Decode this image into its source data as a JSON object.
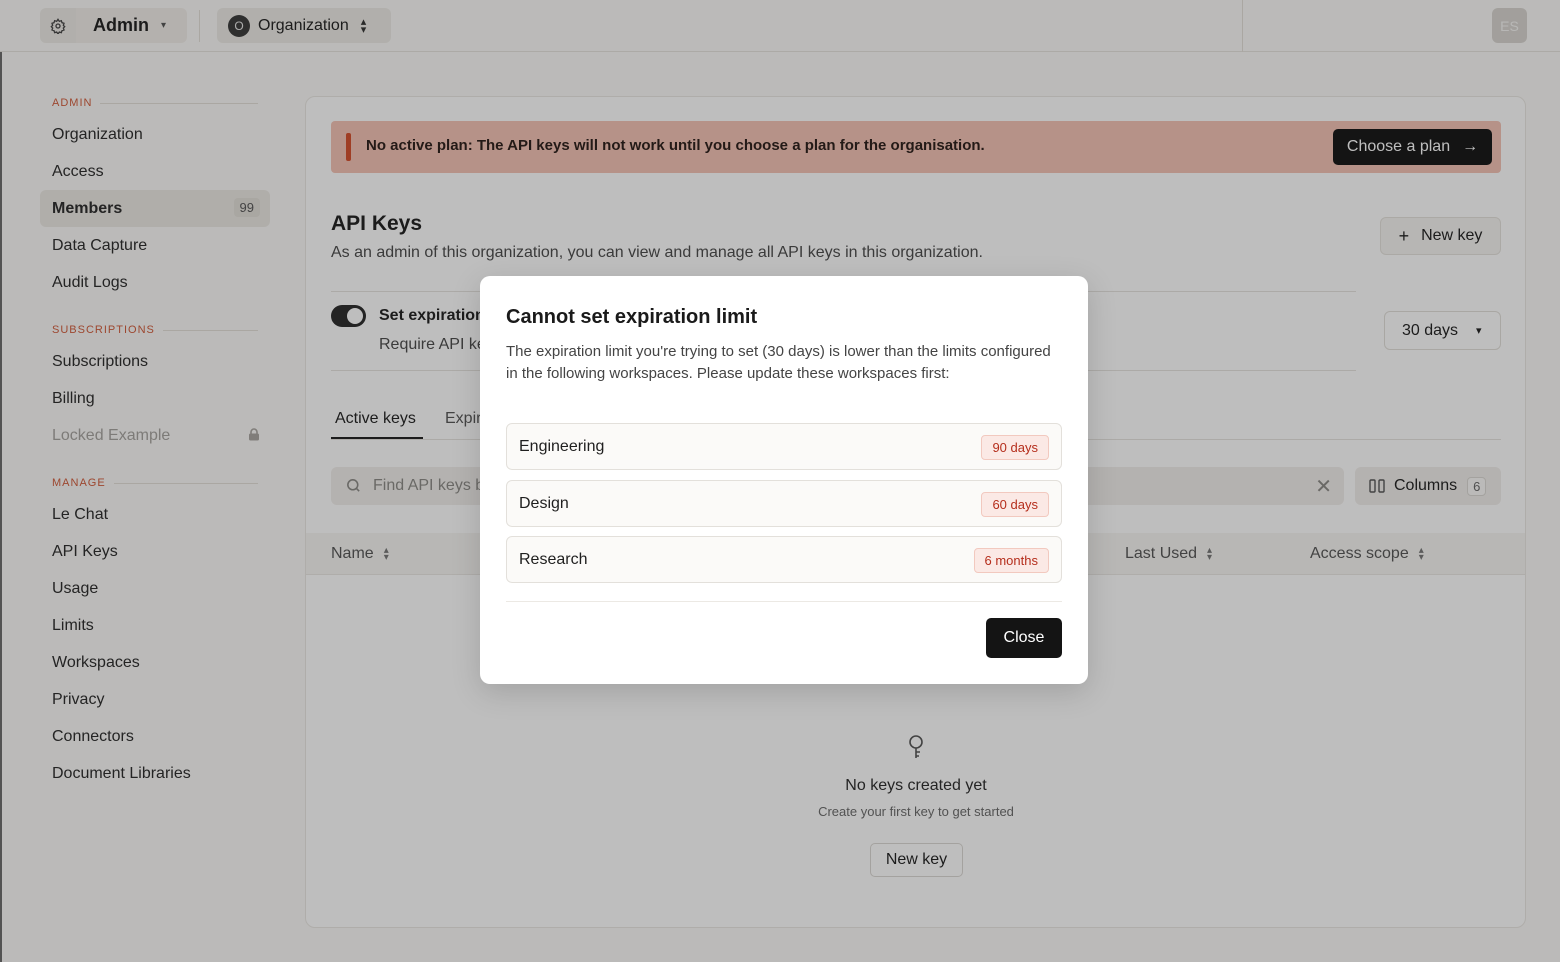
{
  "topbar": {
    "admin_label": "Admin",
    "org_initial": "O",
    "org_label": "Organization",
    "user_initials": "ES"
  },
  "sidebar": {
    "sections": [
      {
        "title": "ADMIN",
        "items": [
          {
            "label": "Organization"
          },
          {
            "label": "Access"
          },
          {
            "label": "Members",
            "count": "99",
            "active": true
          },
          {
            "label": "Data Capture"
          },
          {
            "label": "Audit Logs"
          }
        ]
      },
      {
        "title": "SUBSCRIPTIONS",
        "items": [
          {
            "label": "Subscriptions"
          },
          {
            "label": "Billing"
          },
          {
            "label": "Locked Example",
            "locked": true
          }
        ]
      },
      {
        "title": "MANAGE",
        "items": [
          {
            "label": "Le Chat"
          },
          {
            "label": "API Keys"
          },
          {
            "label": "Usage"
          },
          {
            "label": "Limits"
          },
          {
            "label": "Workspaces"
          },
          {
            "label": "Privacy"
          },
          {
            "label": "Connectors"
          },
          {
            "label": "Document Libraries"
          }
        ]
      }
    ]
  },
  "banner": {
    "message": "No active plan: The API keys will not work until you choose a plan for the organisation.",
    "button_label": "Choose a plan"
  },
  "page": {
    "title": "API Keys",
    "subtitle": "As an admin of this organization, you can view and manage all API keys in this organization.",
    "new_key_label": "New key"
  },
  "expiration": {
    "title": "Set expiration",
    "desc": "Require API ke",
    "selected": "30 days"
  },
  "tabs": [
    {
      "label": "Active keys"
    },
    {
      "label": "Expir"
    }
  ],
  "search": {
    "placeholder": "Find API keys b"
  },
  "columns": {
    "label": "Columns",
    "count": "6"
  },
  "table": {
    "headers": [
      "Name",
      "Last Used",
      "Access scope"
    ]
  },
  "empty": {
    "title": "No keys created yet",
    "subtitle": "Create your first key to get started",
    "button_label": "New key"
  },
  "modal": {
    "title": "Cannot set expiration limit",
    "description": "The expiration limit you're trying to set (30 days) is lower than the limits configured in the following workspaces. Please update these workspaces first:",
    "workspaces": [
      {
        "name": "Engineering",
        "limit": "90 days"
      },
      {
        "name": "Design",
        "limit": "60 days"
      },
      {
        "name": "Research",
        "limit": "6 months"
      }
    ],
    "close_label": "Close"
  },
  "colors": {
    "accent_red": "#d54d2a",
    "banner_bg": "#f4c2b4",
    "primary_button": "#141414"
  }
}
